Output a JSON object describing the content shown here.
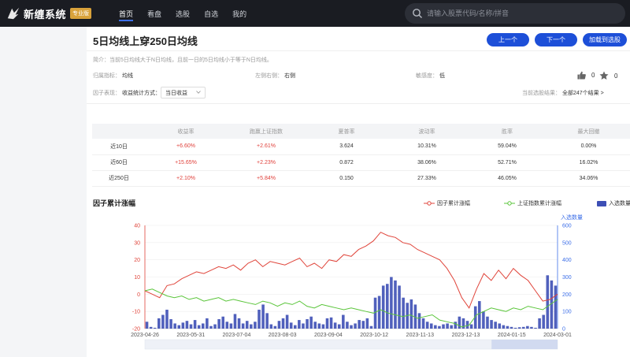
{
  "app": {
    "name": "新缠系统",
    "badge": "专业版",
    "nav": [
      "首页",
      "看盘",
      "选股",
      "自选",
      "我的"
    ],
    "search_placeholder": "请输入股票代码/名称/拼音"
  },
  "page": {
    "title": "5日均线上穿250日均线",
    "buttons": {
      "prev": "上一个",
      "next": "下一个",
      "load": "加载到选股"
    },
    "desc_label": "简介：",
    "desc": "当前5日均线大于N日均线，且前一日的5日均线小于等于N日均线。",
    "indicator_label": "归属指标：",
    "indicator": "均线",
    "direction_label": "左侧右侧：",
    "direction": "右侧",
    "sensitivity_label": "敏感度：",
    "sensitivity": "低",
    "likes": "0",
    "favorites": "0",
    "factor_label": "因子表现：",
    "stat_method_label": "收益统计方式：",
    "stat_method": "当日收益",
    "result_label": "当前选股结果：",
    "result_value": "全部247个结果 >"
  },
  "stats": {
    "headers": [
      "",
      "收益率",
      "跑赢上证指数",
      "夏普率",
      "波动率",
      "胜率",
      "最大回撤"
    ],
    "rows": [
      [
        "近10日",
        "+6.60%",
        "+2.61%",
        "3.624",
        "10.31%",
        "59.04%",
        "0.00%"
      ],
      [
        "近60日",
        "+15.65%",
        "+2.23%",
        "0.872",
        "38.06%",
        "52.71%",
        "16.02%"
      ],
      [
        "近250日",
        "+2.10%",
        "+5.84%",
        "0.150",
        "27.33%",
        "46.05%",
        "34.06%"
      ]
    ]
  },
  "chart_title": "因子累计涨幅",
  "colors": {
    "factor": "#e0453b",
    "index": "#5ac53a",
    "bars": "#3d4fb5",
    "accent": "#1d4fd8"
  },
  "chart_data": {
    "type": "line",
    "series": [
      {
        "name": "因子累计涨幅",
        "axis": "left",
        "values": [
          2,
          0,
          -2,
          5,
          6,
          9,
          11,
          13,
          12,
          14,
          16,
          15,
          17,
          14,
          18,
          20,
          16,
          19,
          18,
          17,
          19,
          21,
          16,
          18,
          15,
          20,
          19,
          23,
          22,
          26,
          28,
          31,
          36,
          34,
          33,
          30,
          29,
          26,
          24,
          22,
          20,
          15,
          8,
          -2,
          -8,
          3,
          12,
          8,
          14,
          9,
          15,
          11,
          8,
          2,
          -4,
          -3,
          0
        ]
      },
      {
        "name": "上证指数累计涨幅",
        "axis": "left",
        "values": [
          2,
          3,
          1,
          -1,
          -2,
          -1,
          -3,
          -2,
          -4,
          -3,
          -2,
          -4,
          -3,
          -4,
          -5,
          -6,
          -4,
          -5,
          -7,
          -5,
          -6,
          -4,
          -7,
          -8,
          -6,
          -7,
          -8,
          -9,
          -8,
          -9,
          -10,
          -11,
          -9,
          -11,
          -12,
          -13,
          -12,
          -14,
          -13,
          -12,
          -15,
          -16,
          -17,
          -19,
          -18,
          -12,
          -10,
          -8,
          -9,
          -10,
          -8,
          -9,
          -7,
          -8,
          -9,
          -6,
          -3
        ]
      },
      {
        "name": "入选数量",
        "axis": "right",
        "type": "bar",
        "values": [
          40,
          10,
          5,
          60,
          80,
          110,
          55,
          30,
          20,
          35,
          45,
          25,
          50,
          20,
          30,
          60,
          15,
          25,
          55,
          70,
          40,
          30,
          85,
          60,
          30,
          45,
          25,
          40,
          110,
          140,
          90,
          25,
          15,
          45,
          60,
          80,
          35,
          20,
          50,
          30,
          55,
          70,
          40,
          30,
          25,
          60,
          65,
          35,
          25,
          80,
          40,
          20,
          30,
          50,
          45,
          60,
          15,
          180,
          190,
          250,
          260,
          300,
          280,
          250,
          180,
          150,
          170,
          140,
          90,
          60,
          40,
          30,
          20,
          15,
          25,
          30,
          20,
          40,
          70,
          60,
          45,
          25,
          130,
          160,
          100,
          70,
          50,
          40,
          30,
          20,
          15,
          10,
          5,
          8,
          10,
          15,
          10,
          5,
          60,
          80,
          310,
          280,
          250
        ]
      }
    ],
    "x": [
      "2023-04-26",
      "2023-05-31",
      "2023-07-04",
      "2023-08-03",
      "2023-09-04",
      "2023-10-12",
      "2023-11-13",
      "2023-12-13",
      "2024-01-15",
      "2024-03-01"
    ],
    "ylim_left": [
      -20,
      40
    ],
    "ylim_right": [
      0,
      600
    ],
    "yticks_left": [
      "40",
      "30",
      "20",
      "10",
      "0",
      "-10",
      "-20"
    ],
    "yticks_right": [
      "600",
      "500",
      "400",
      "300",
      "200",
      "100",
      "0"
    ],
    "right_axis_label": "入选数量",
    "legend": [
      "因子累计涨幅",
      "上证指数累计涨幅",
      "入选数量"
    ],
    "legend_position": "top-right",
    "grid": true
  }
}
